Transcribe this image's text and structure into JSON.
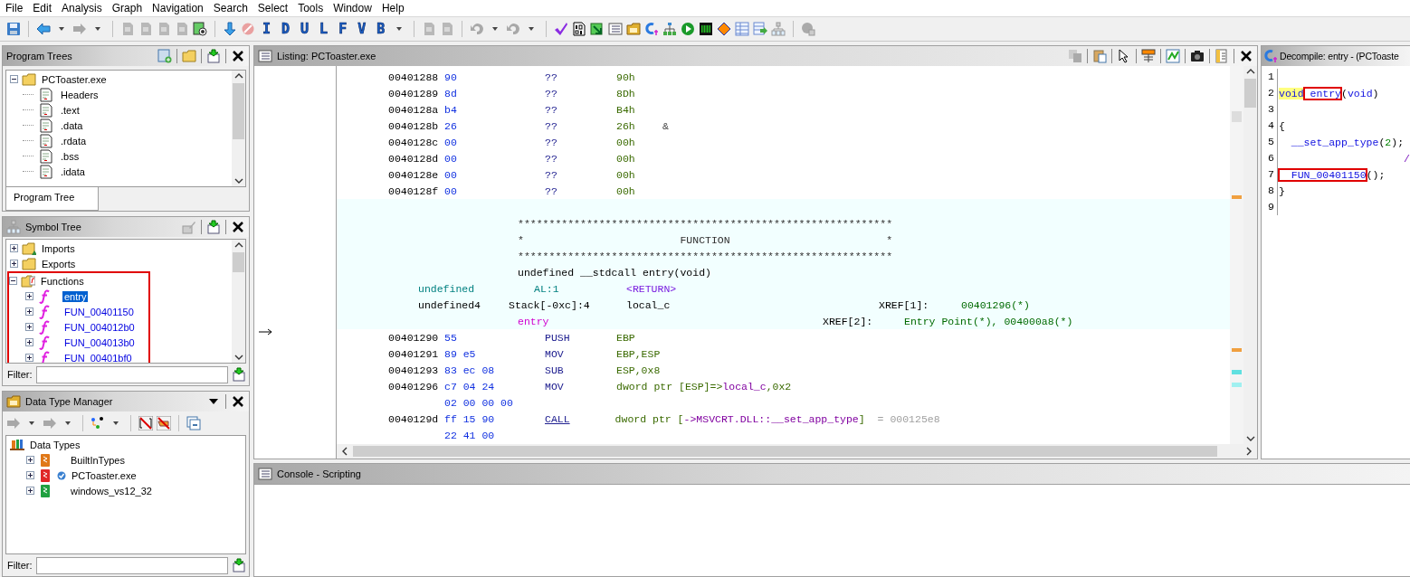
{
  "menu": [
    {
      "label": "File"
    },
    {
      "label": "Edit"
    },
    {
      "label": "Analysis"
    },
    {
      "label": "Graph"
    },
    {
      "label": "Navigation"
    },
    {
      "label": "Search"
    },
    {
      "label": "Select"
    },
    {
      "label": "Tools"
    },
    {
      "label": "Window"
    },
    {
      "label": "Help"
    }
  ],
  "toolbar": {
    "letter_buttons": [
      {
        "label": "I"
      },
      {
        "label": "D"
      },
      {
        "label": "U"
      },
      {
        "label": "L"
      },
      {
        "label": "F"
      },
      {
        "label": "V"
      },
      {
        "label": "B"
      }
    ]
  },
  "program_trees": {
    "title": "Program Trees",
    "root": {
      "label": "PCToaster.exe",
      "expanded": true,
      "children": [
        {
          "label": "Headers"
        },
        {
          "label": ".text"
        },
        {
          "label": ".data"
        },
        {
          "label": ".rdata"
        },
        {
          "label": ".bss"
        },
        {
          "label": ".idata"
        }
      ]
    },
    "tab": {
      "label": "Program Tree"
    }
  },
  "symbol_tree": {
    "title": "Symbol Tree",
    "items": [
      {
        "label": "Imports",
        "kind": "imports",
        "expanded": false,
        "annotated": false
      },
      {
        "label": "Exports",
        "kind": "exports",
        "expanded": false,
        "annotated": false
      },
      {
        "label": "Functions",
        "kind": "functions",
        "expanded": true,
        "annotated": true,
        "children": [
          {
            "label": "entry",
            "selected": true
          },
          {
            "label": "FUN_00401150",
            "selected": false
          },
          {
            "label": "FUN_004012b0",
            "selected": false
          },
          {
            "label": "FUN_004013b0",
            "selected": false
          },
          {
            "label": "FUN_00401bf0",
            "selected": false
          }
        ]
      }
    ],
    "filter_label": "Filter:"
  },
  "data_type_manager": {
    "title": "Data Type Manager",
    "root": "Data Types",
    "items": [
      {
        "label": "BuiltInTypes",
        "color": "#e07818",
        "checked": false
      },
      {
        "label": "PCToaster.exe",
        "color": "#e02828",
        "checked": true
      },
      {
        "label": "windows_vs12_32",
        "color": "#20a040",
        "checked": false
      }
    ],
    "filter_label": "Filter:"
  },
  "listing": {
    "title": "Listing:  PCToaster.exe",
    "rows": [
      {
        "kind": "code",
        "address": "00401288",
        "bytes": "90",
        "mnemonic": "??",
        "underlined": false,
        "operand": [
          {
            "text": "90h",
            "kind": "plain"
          }
        ]
      },
      {
        "kind": "code",
        "address": "00401289",
        "bytes": "8d",
        "mnemonic": "??",
        "underlined": false,
        "operand": [
          {
            "text": "8Dh",
            "kind": "plain"
          }
        ]
      },
      {
        "kind": "code",
        "address": "0040128a",
        "bytes": "b4",
        "mnemonic": "??",
        "underlined": false,
        "operand": [
          {
            "text": "B4h",
            "kind": "plain"
          }
        ]
      },
      {
        "kind": "code",
        "address": "0040128b",
        "bytes": "26",
        "mnemonic": "??",
        "underlined": false,
        "operand": [
          {
            "text": "26h",
            "kind": "plain"
          }
        ],
        "comment": {
          "text": "&",
          "kind": "char"
        }
      },
      {
        "kind": "code",
        "address": "0040128c",
        "bytes": "00",
        "mnemonic": "??",
        "underlined": false,
        "operand": [
          {
            "text": "00h",
            "kind": "plain"
          }
        ]
      },
      {
        "kind": "code",
        "address": "0040128d",
        "bytes": "00",
        "mnemonic": "??",
        "underlined": false,
        "operand": [
          {
            "text": "00h",
            "kind": "plain"
          }
        ]
      },
      {
        "kind": "code",
        "address": "0040128e",
        "bytes": "00",
        "mnemonic": "??",
        "underlined": false,
        "operand": [
          {
            "text": "00h",
            "kind": "plain"
          }
        ]
      },
      {
        "kind": "code",
        "address": "0040128f",
        "bytes": "00",
        "mnemonic": "??",
        "underlined": false,
        "operand": [
          {
            "text": "00h",
            "kind": "plain"
          }
        ]
      },
      {
        "kind": "blank"
      },
      {
        "kind": "banner",
        "text": "************************************************************"
      },
      {
        "kind": "banner",
        "text": "*                         FUNCTION                         *"
      },
      {
        "kind": "banner",
        "text": "************************************************************"
      },
      {
        "kind": "signature",
        "text": "undefined __stdcall entry(void)"
      },
      {
        "kind": "return_variable",
        "type": "undefined",
        "storage": "AL:1",
        "name": "<RETURN>"
      },
      {
        "kind": "variable",
        "type": "undefined4",
        "storage": "Stack[-0xc]:4",
        "name": "local_c",
        "xref": {
          "label": "XREF[1]:",
          "value": "00401296(*)"
        }
      },
      {
        "kind": "label",
        "text": "entry",
        "xref": {
          "label": "XREF[2]:",
          "value": "Entry Point(*), 004000a8(*)"
        }
      },
      {
        "kind": "code",
        "address": "00401290",
        "bytes": "55",
        "mnemonic": "PUSH",
        "underlined": false,
        "operand": [
          {
            "text": "EBP",
            "kind": "plain"
          }
        ]
      },
      {
        "kind": "code",
        "address": "00401291",
        "bytes": "89 e5",
        "mnemonic": "MOV",
        "underlined": false,
        "operand": [
          {
            "text": "EBP,ESP",
            "kind": "plain"
          }
        ]
      },
      {
        "kind": "code",
        "address": "00401293",
        "bytes": "83 ec 08",
        "mnemonic": "SUB",
        "underlined": false,
        "operand": [
          {
            "text": "ESP,0x8",
            "kind": "plain"
          }
        ]
      },
      {
        "kind": "code",
        "address": "00401296",
        "bytes": "c7 04 24",
        "mnemonic": "MOV",
        "underlined": false,
        "operand": [
          {
            "text": "dword ptr [ESP]=>",
            "kind": "plain"
          },
          {
            "text": "local_c",
            "kind": "ref"
          },
          {
            "text": ",0x2",
            "kind": "plain"
          }
        ]
      },
      {
        "kind": "bytes",
        "bytes": "02 00 00 00"
      },
      {
        "kind": "code",
        "address": "0040129d",
        "bytes": "ff 15 90",
        "mnemonic": "CALL",
        "underlined": true,
        "operand": [
          {
            "text": "dword ptr [",
            "kind": "plain"
          },
          {
            "text": "->MSVCRT.DLL::__set_app_type",
            "kind": "ref"
          },
          {
            "text": "]",
            "kind": "plain"
          }
        ],
        "comment": {
          "text": "= 000125e8",
          "kind": "value"
        }
      },
      {
        "kind": "bytes",
        "bytes": "22 41 00"
      }
    ]
  },
  "decompile": {
    "title": "Decompile: entry -  (PCToaste",
    "lines": [
      {
        "number": "1"
      },
      {
        "number": "2",
        "tokens": [
          {
            "text": "void",
            "kind": "keyword",
            "highlighted": true
          },
          {
            "text": " entry",
            "kind": "func",
            "annotated": true
          },
          {
            "text": "(",
            "kind": "punct"
          },
          {
            "text": "void",
            "kind": "keyword"
          },
          {
            "text": ")",
            "kind": "punct"
          }
        ]
      },
      {
        "number": "3"
      },
      {
        "number": "4",
        "tokens": [
          {
            "text": "{",
            "kind": "punct"
          }
        ]
      },
      {
        "number": "5",
        "tokens": [
          {
            "text": "  __set_app_type",
            "kind": "func"
          },
          {
            "text": "(",
            "kind": "punct"
          },
          {
            "text": "2",
            "kind": "number"
          },
          {
            "text": ");",
            "kind": "punct"
          }
        ]
      },
      {
        "number": "6",
        "tokens": [
          {
            "text": "                    /",
            "kind": "comment"
          }
        ]
      },
      {
        "number": "7",
        "tokens": [
          {
            "text": "  FUN_00401150",
            "kind": "func",
            "annotated": true
          },
          {
            "text": "();",
            "kind": "punct"
          }
        ]
      },
      {
        "number": "8",
        "tokens": [
          {
            "text": "}",
            "kind": "punct"
          }
        ]
      },
      {
        "number": "9"
      }
    ]
  },
  "console": {
    "title": "Console - Scripting"
  }
}
